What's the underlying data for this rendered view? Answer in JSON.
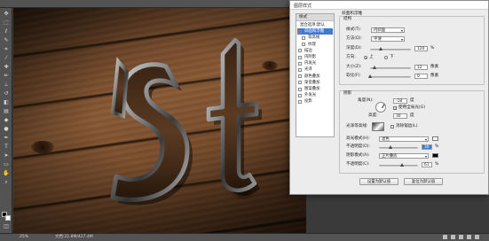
{
  "statusbar": {
    "zoom": "25%",
    "doc_info": "文档:21.8M/427.4M"
  },
  "dialog": {
    "title": "图层样式",
    "styles_header": "样式",
    "styles": [
      {
        "label": "混合选项:默认",
        "checked": false,
        "selected": false,
        "sub": false
      },
      {
        "label": "斜面和浮雕",
        "checked": true,
        "selected": true,
        "sub": false
      },
      {
        "label": "等高线",
        "checked": false,
        "selected": false,
        "sub": true
      },
      {
        "label": "纹理",
        "checked": false,
        "selected": false,
        "sub": true
      },
      {
        "label": "描边",
        "checked": false,
        "selected": false,
        "sub": false
      },
      {
        "label": "内阴影",
        "checked": false,
        "selected": false,
        "sub": false
      },
      {
        "label": "内发光",
        "checked": false,
        "selected": false,
        "sub": false
      },
      {
        "label": "光泽",
        "checked": false,
        "selected": false,
        "sub": false
      },
      {
        "label": "颜色叠加",
        "checked": false,
        "selected": false,
        "sub": false
      },
      {
        "label": "渐变叠加",
        "checked": false,
        "selected": false,
        "sub": false
      },
      {
        "label": "图案叠加",
        "checked": false,
        "selected": false,
        "sub": false
      },
      {
        "label": "外发光",
        "checked": false,
        "selected": false,
        "sub": false
      },
      {
        "label": "投影",
        "checked": false,
        "selected": false,
        "sub": false
      }
    ],
    "section_title": "斜面和浮雕",
    "structure": {
      "title": "结构",
      "style_label": "样式(T):",
      "style_value": "内斜面",
      "method_label": "方法(Q):",
      "method_value": "平滑",
      "depth_label": "深度(D):",
      "depth_value": "120",
      "depth_unit": "%",
      "direction_label": "方向:",
      "direction_up": "上",
      "direction_down": "下",
      "size_label": "大小(Z):",
      "size_value": "12",
      "size_unit": "像素",
      "soften_label": "软化(F):",
      "soften_value": "0",
      "soften_unit": "像素"
    },
    "shading": {
      "title": "阴影",
      "angle_label": "角度(N):",
      "angle_value": "-18",
      "angle_unit": "度",
      "global_light_label": "使用全局光(G)",
      "altitude_label": "高度:",
      "altitude_value": "30",
      "altitude_unit": "度",
      "gloss_label": "光泽等高线:",
      "antialias_label": "消除锯齿(L)",
      "highlight_label": "高光模式(H):",
      "highlight_value": "滤色",
      "highlight_color": "#ffffff",
      "opacity1_label": "不透明度(O):",
      "opacity1_value": "30",
      "opacity1_unit": "%",
      "shadow_label": "阴影模式(A):",
      "shadow_value": "正片叠底",
      "shadow_color": "#000000",
      "opacity2_label": "不透明度(C):",
      "opacity2_value": "61",
      "opacity2_unit": "%"
    },
    "buttons": {
      "set_default": "设置为默认值",
      "reset_default": "复位为默认值"
    }
  }
}
